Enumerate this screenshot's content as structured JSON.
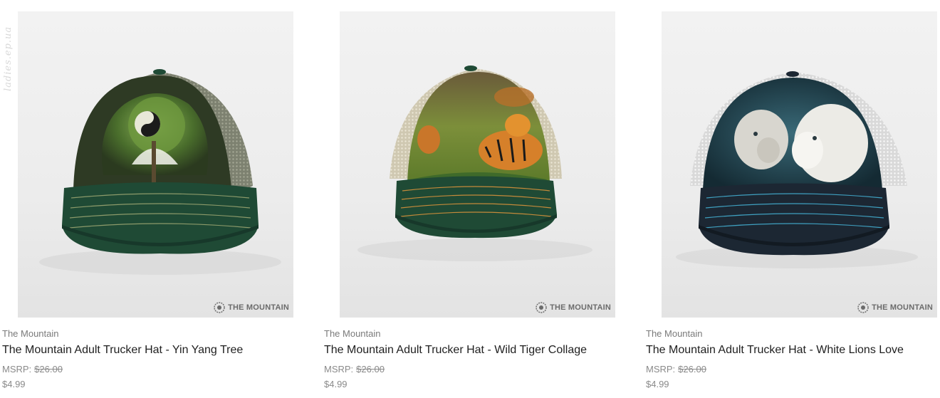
{
  "watermark": "ladies.ep.ua",
  "brand_logo_text": "THE MOUNTAIN",
  "msrp_label": "MSRP:",
  "products": [
    {
      "vendor": "The Mountain",
      "title": "The Mountain Adult Trucker Hat - Yin Yang Tree",
      "msrp": "$26.00",
      "price": "$4.99",
      "colors": {
        "front": "#2e3a24",
        "mesh": "#8a8d7a",
        "brim": "#1f4a35",
        "art": "#5e8a3a"
      }
    },
    {
      "vendor": "The Mountain",
      "title": "The Mountain Adult Trucker Hat - Wild Tiger Collage",
      "msrp": "$26.00",
      "price": "$4.99",
      "colors": {
        "front": "#7a8a3c",
        "mesh": "#d8d2bd",
        "brim": "#1f4a35",
        "art": "#d6802a"
      }
    },
    {
      "vendor": "The Mountain",
      "title": "The Mountain Adult Trucker Hat - White Lions Love",
      "msrp": "$26.00",
      "price": "$4.99",
      "colors": {
        "front": "#1c3a45",
        "mesh": "#f0f0f0",
        "brim": "#1c2733",
        "art": "#e6e4de"
      }
    }
  ]
}
